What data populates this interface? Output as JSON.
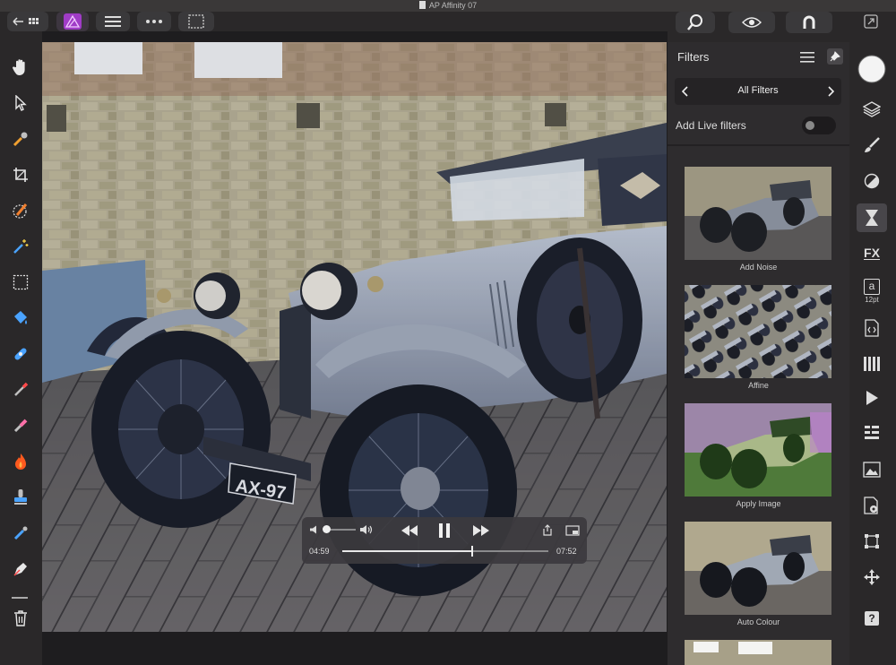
{
  "window": {
    "title": "AP Affinity 07"
  },
  "top_toolbar": {
    "back_icon": "back-arrow-grid-icon",
    "persona_icon": "affinity-photo-icon",
    "menu_icon": "hamburger-icon",
    "more_icon": "ellipsis-icon",
    "select_icon": "selection-icon"
  },
  "left_tools": [
    "hand-icon",
    "pointer-icon",
    "color-picker-icon",
    "crop-icon",
    "selection-brush-icon",
    "magic-wand-icon",
    "marquee-icon",
    "flood-fill-icon",
    "healing-brush-icon",
    "paint-brush-icon",
    "eraser-icon",
    "burn-icon",
    "clone-stamp-icon",
    "smudge-icon",
    "pen-icon",
    "trash-icon"
  ],
  "filters_panel": {
    "title": "Filters",
    "nav_label": "All Filters",
    "live_label": "Add Live filters",
    "live_enabled": false,
    "items": [
      {
        "label": "Add Noise"
      },
      {
        "label": "Affine"
      },
      {
        "label": "Apply Image"
      },
      {
        "label": "Auto Colour"
      }
    ]
  },
  "right_tools": [
    {
      "icon": "color-circle-icon"
    },
    {
      "icon": "layers-icon"
    },
    {
      "icon": "brushes-icon"
    },
    {
      "icon": "adjustments-icon"
    },
    {
      "icon": "filters-icon",
      "active": true
    },
    {
      "icon": "fx-icon",
      "label": "FX"
    },
    {
      "icon": "text-style-icon",
      "label": "a",
      "sublabel": "12pt"
    },
    {
      "icon": "code-icon"
    },
    {
      "icon": "channels-icon"
    },
    {
      "icon": "play-macro-icon"
    },
    {
      "icon": "history-icon"
    },
    {
      "icon": "navigator-icon"
    },
    {
      "icon": "settings-icon"
    },
    {
      "icon": "transform-icon"
    },
    {
      "icon": "move-icon"
    },
    {
      "icon": "help-icon",
      "label": "?"
    }
  ],
  "media_player": {
    "elapsed": "04:59",
    "duration": "07:52",
    "progress": 0.63,
    "volume": 0.08
  },
  "license_plate": "AX-97"
}
